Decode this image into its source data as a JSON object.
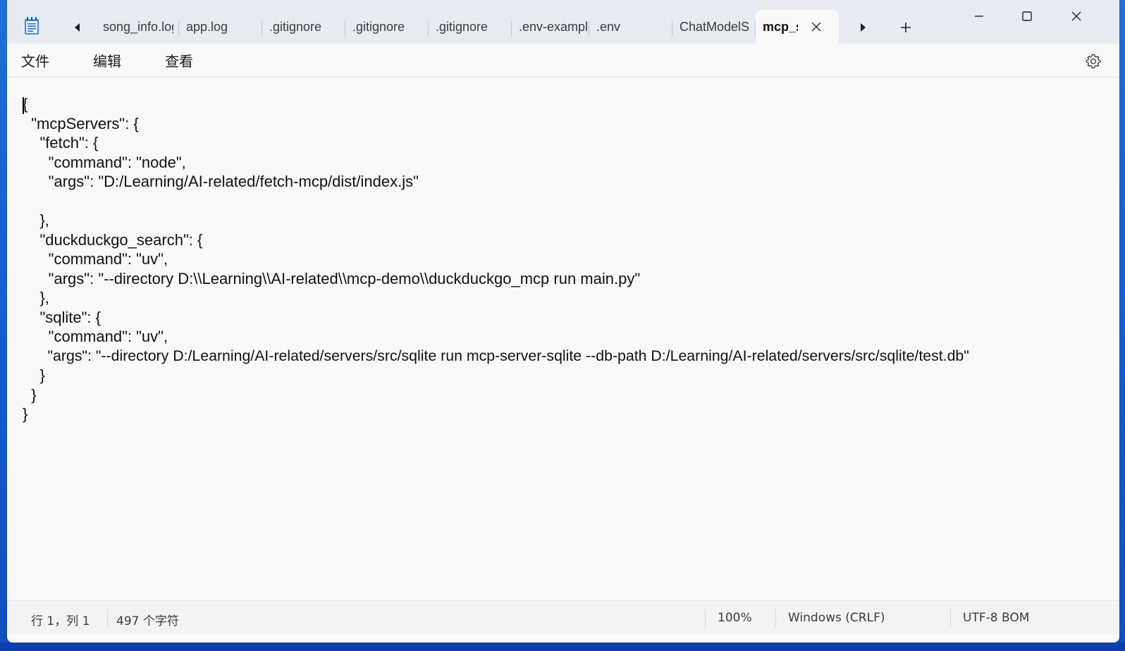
{
  "tabs": [
    {
      "label": "song_info.log"
    },
    {
      "label": "app.log"
    },
    {
      "label": ".gitignore"
    },
    {
      "label": ".gitignore"
    },
    {
      "label": ".gitignore"
    },
    {
      "label": ".env-example"
    },
    {
      "label": ".env"
    },
    {
      "label": "ChatModelS"
    },
    {
      "label": "mcp_s",
      "active": true
    }
  ],
  "menu": {
    "file": "文件",
    "edit": "编辑",
    "view": "查看"
  },
  "editor": {
    "lines": [
      "{",
      "  \"mcpServers\": {",
      "    \"fetch\": {",
      "      \"command\": \"node\",",
      "      \"args\": \"D:/Learning/AI-related/fetch-mcp/dist/index.js\"",
      "",
      "    },",
      "    \"duckduckgo_search\": {",
      "      \"command\": \"uv\",",
      "      \"args\": \"--directory D:\\\\Learning\\\\AI-related\\\\mcp-demo\\\\duckduckgo_mcp run main.py\"",
      "    },",
      "    \"sqlite\": {",
      "      \"command\": \"uv\",",
      "      \"args\": \"--directory D:/Learning/AI-related/servers/src/sqlite run mcp-server-sqlite --db-path D:/Learning/AI-related/servers/src/sqlite/test.db\"",
      "    }",
      "  }",
      "}"
    ]
  },
  "status": {
    "position": "行 1，列 1",
    "char_count": "497 个字符",
    "zoom": "100%",
    "line_ending": "Windows (CRLF)",
    "encoding": "UTF-8 BOM"
  },
  "icons": {
    "app": "notepad-icon",
    "tab_scroll_left": "caret-left-icon",
    "tab_scroll_right": "caret-right-icon",
    "new_tab": "plus-icon",
    "close_tab": "close-icon",
    "minimize": "minimize-icon",
    "maximize": "maximize-icon",
    "close_window": "close-icon",
    "settings": "gear-icon"
  }
}
